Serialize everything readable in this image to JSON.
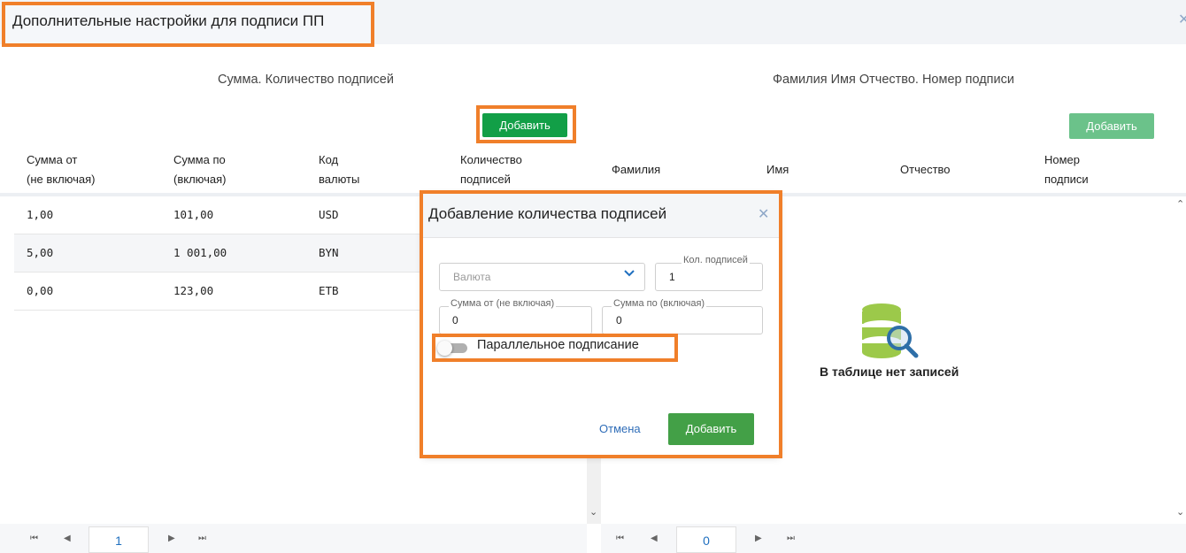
{
  "header": {
    "title": "Дополнительные настройки для подписи ПП",
    "close_icon": "close-icon"
  },
  "left_panel": {
    "title": "Сумма. Количество подписей",
    "add_label": "Добавить",
    "columns": [
      {
        "line1": "Сумма от",
        "line2": "(не включая)"
      },
      {
        "line1": "Сумма по",
        "line2": "(включая)"
      },
      {
        "line1": "Код",
        "line2": "валюты"
      },
      {
        "line1": "Количество",
        "line2": "подписей"
      }
    ],
    "rows": [
      {
        "from": "1,00",
        "to": "101,00",
        "currency": "USD"
      },
      {
        "from": "5,00",
        "to": "1 001,00",
        "currency": "BYN"
      },
      {
        "from": "0,00",
        "to": "123,00",
        "currency": "ETB"
      }
    ],
    "page": "1"
  },
  "right_panel": {
    "title": "Фамилия Имя Отчество. Номер подписи",
    "add_label": "Добавить",
    "columns": [
      {
        "line1": "Фамилия",
        "line2": ""
      },
      {
        "line1": "Имя",
        "line2": ""
      },
      {
        "line1": "Отчество",
        "line2": ""
      },
      {
        "line1": "Номер",
        "line2": "подписи"
      }
    ],
    "empty_text": "В таблице нет записей",
    "page": "0"
  },
  "modal": {
    "title": "Добавление количества подписей",
    "currency_placeholder": "Валюта",
    "count_label": "Кол. подписей",
    "count_value": "1",
    "sum_from_label": "Сумма от (не включая)",
    "sum_from_value": "0",
    "sum_to_label": "Сумма по (включая)",
    "sum_to_value": "0",
    "parallel_label": "Параллельное подписание",
    "parallel_on": false,
    "cancel_label": "Отмена",
    "submit_label": "Добавить"
  },
  "colors": {
    "primary_green": "#129f47",
    "highlight": "#f07f2a",
    "link_blue": "#2f6db8"
  }
}
